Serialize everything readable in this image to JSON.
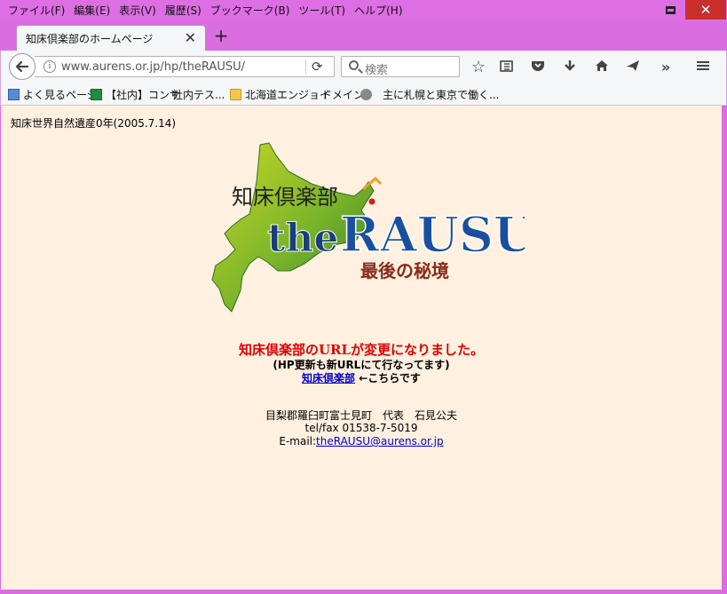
{
  "menu": [
    "ファイル(F)",
    "編集(E)",
    "表示(V)",
    "履歴(S)",
    "ブックマーク(B)",
    "ツール(T)",
    "ヘルプ(H)"
  ],
  "tab": {
    "title": "知床倶楽部のホームページ"
  },
  "navbar": {
    "url": "www.aurens.or.jp/hp/theRAUSU/",
    "search_placeholder": "検索"
  },
  "bookmarks": [
    {
      "label": "よく見るページ",
      "icon": "bookmark-page-icon"
    },
    {
      "label": "【社内】コンサ",
      "icon": "spreadsheet-icon"
    },
    {
      "label": "社内テス...",
      "icon": "none"
    },
    {
      "label": "北海道エンジョイ",
      "icon": "folder-icon"
    },
    {
      "label": "ドメイン",
      "icon": "none"
    },
    {
      "label": "主に札幌と東京で働く...",
      "icon": "globe-icon"
    }
  ],
  "page": {
    "heritage": "知床世界自然遺産0年(2005.7.14)",
    "logo": {
      "top_text": "知床倶楽部",
      "main_text_the": "the",
      "main_text_rausu": "RAUSU",
      "sub_text": "最後の秘境"
    },
    "notice_red": "知床倶楽部のURLが変更になりました。",
    "notice_sub": "(HP更新も新URLにて行なってます)",
    "link_text": "知床倶楽部",
    "link_suffix": " ←こちらです",
    "address": "目梨郡羅臼町富士見町　代表　石見公夫",
    "tel": "tel/fax 01538-7-5019",
    "email_label": "E-mail:",
    "email": "theRAUSU@aurens.or.jp"
  },
  "colors": {
    "frame": "#da6ee0",
    "page_bg": "#fff0e0",
    "notice_red": "#e00000",
    "link": "#0000cc"
  }
}
